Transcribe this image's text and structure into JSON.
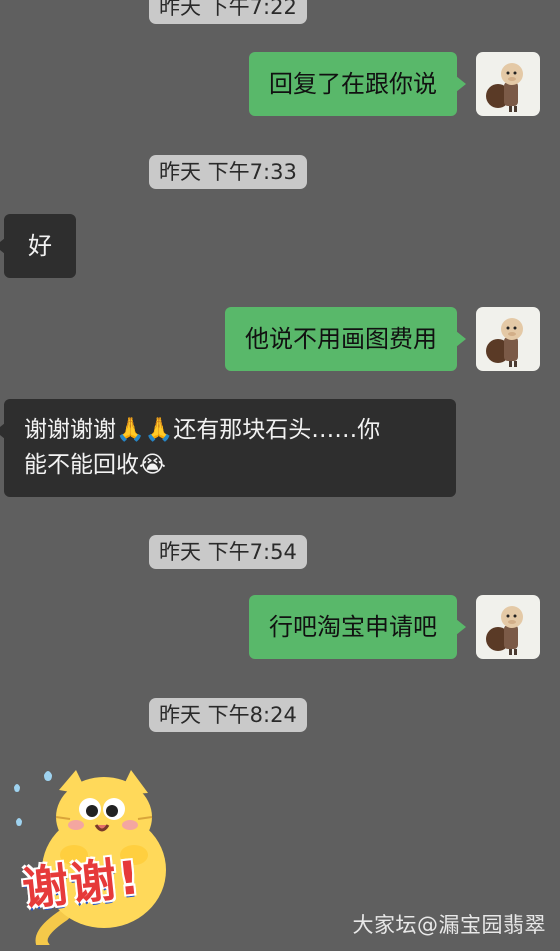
{
  "messages": [
    {
      "type": "timestamp",
      "text": "昨天 下午7:22"
    },
    {
      "type": "outgoing",
      "text": "回复了在跟你说"
    },
    {
      "type": "timestamp",
      "text": "昨天 下午7:33"
    },
    {
      "type": "incoming",
      "text": "好"
    },
    {
      "type": "outgoing",
      "text": "他说不用画图费用"
    },
    {
      "type": "incoming",
      "line1": "谢谢谢谢🙏🙏还有那块石头……你",
      "line2": "能不能回收😭"
    },
    {
      "type": "timestamp",
      "text": "昨天 下午7:54"
    },
    {
      "type": "outgoing",
      "text": "行吧淘宝申请吧"
    },
    {
      "type": "timestamp",
      "text": "昨天 下午8:24"
    },
    {
      "type": "sticker",
      "text": "谢谢!"
    }
  ],
  "avatar_icon": "monk-figure-icon",
  "watermark": "大家坛@漏宝园翡翠",
  "colors": {
    "background": "#5f5f5f",
    "outgoing_bubble": "#59b86a",
    "incoming_bubble": "#2e2e2e",
    "timestamp_bg": "#c9c9c9"
  }
}
